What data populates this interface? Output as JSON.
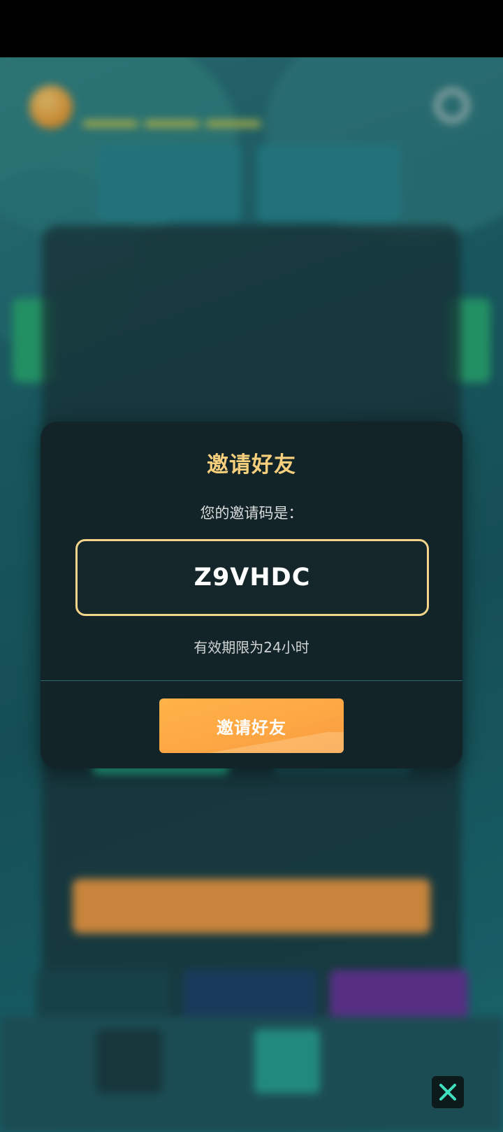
{
  "dialog": {
    "title": "邀请好友",
    "code_label": "您的邀请码是：",
    "invite_code": "Z9VHDC",
    "validity_note": "有效期限为24小时",
    "invite_button_label": "邀请好友"
  },
  "colors": {
    "dialog_bg": "#132428",
    "title_accent": "#f5cf7c",
    "code_border": "#f3d48a",
    "button_orange": "#fda644"
  },
  "icons": {
    "close": "close-icon"
  }
}
